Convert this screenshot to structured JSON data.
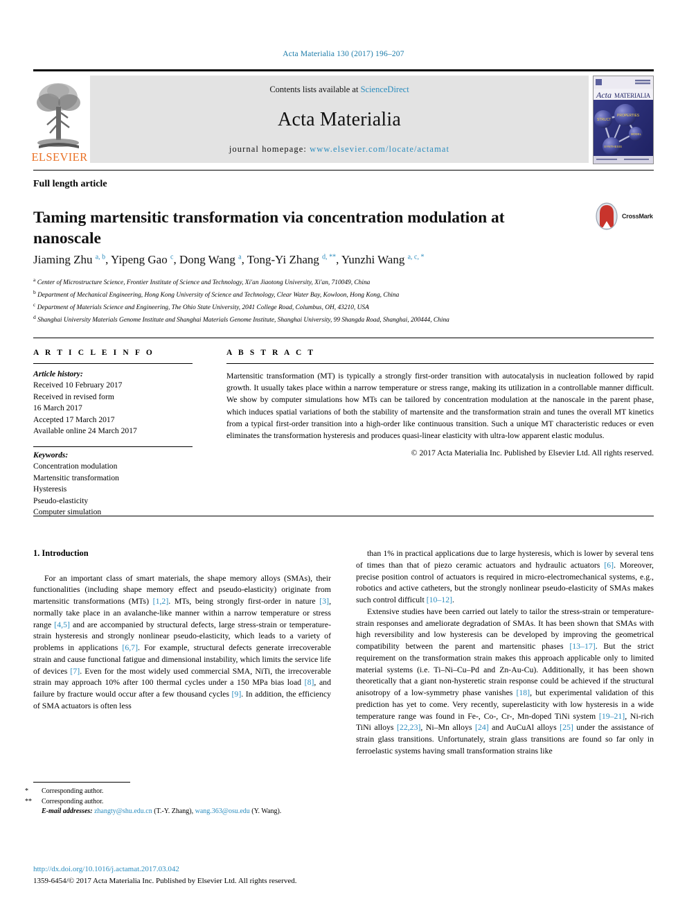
{
  "running_head": "Acta Materialia 130 (2017) 196–207",
  "masthead": {
    "publisher_name": "ELSEVIER",
    "contents_prefix": "Contents lists available at ",
    "contents_link": "ScienceDirect",
    "journal_name": "Acta Materialia",
    "homepage_prefix": "journal homepage: ",
    "homepage_url": "www.elsevier.com/locate/actamat",
    "cover_title_1": "Acta",
    "cover_title_2": "MATERIALIA",
    "cover_nodes": [
      "STRUCTURE",
      "PROPERTIES",
      "MODELING",
      "SYNTHESIS"
    ]
  },
  "article_type": "Full length article",
  "title": "Taming martensitic transformation via concentration modulation at nanoscale",
  "crossmark": {
    "label": "CrossMark"
  },
  "authors_html": "Jiaming Zhu <sup>a, b</sup>, Yipeng Gao <sup>c</sup>, Dong Wang <sup>a</sup>, Tong-Yi Zhang <sup>d, **</sup>, Yunzhi Wang <sup>a, c, *</sup>",
  "affiliations": [
    {
      "marker": "a",
      "text": "Center of Microstructure Science, Frontier Institute of Science and Technology, Xi'an Jiaotong University, Xi'an, 710049, China"
    },
    {
      "marker": "b",
      "text": "Department of Mechanical Engineering, Hong Kong University of Science and Technology, Clear Water Bay, Kowloon, Hong Kong, China"
    },
    {
      "marker": "c",
      "text": "Department of Materials Science and Engineering, The Ohio State University, 2041 College Road, Columbus, OH, 43210, USA"
    },
    {
      "marker": "d",
      "text": "Shanghai University Materials Genome Institute and Shanghai Materials Genome Institute, Shanghai University, 99 Shangda Road, Shanghai, 200444, China"
    }
  ],
  "article_info": {
    "heading": "A R T I C L E  I N F O",
    "history_label": "Article history:",
    "history_lines": [
      "Received 10 February 2017",
      "Received in revised form",
      "16 March 2017",
      "Accepted 17 March 2017",
      "Available online 24 March 2017"
    ],
    "keywords_label": "Keywords:",
    "keywords": [
      "Concentration modulation",
      "Martensitic transformation",
      "Hysteresis",
      "Pseudo-elasticity",
      "Computer simulation"
    ]
  },
  "abstract": {
    "heading": "A B S T R A C T",
    "text": "Martensitic transformation (MT) is typically a strongly first-order transition with autocatalysis in nucleation followed by rapid growth. It usually takes place within a narrow temperature or stress range, making its utilization in a controllable manner difficult. We show by computer simulations how MTs can be tailored by concentration modulation at the nanoscale in the parent phase, which induces spatial variations of both the stability of martensite and the transformation strain and tunes the overall MT kinetics from a typical first-order transition into a high-order like continuous transition. Such a unique MT characteristic reduces or even eliminates the transformation hysteresis and produces quasi-linear elasticity with ultra-low apparent elastic modulus.",
    "copyright": "© 2017 Acta Materialia Inc. Published by Elsevier Ltd. All rights reserved."
  },
  "body": {
    "section_title": "1. Introduction",
    "left_paragraphs_html": [
      "For an important class of smart materials, the shape memory alloys (SMAs), their functionalities (including shape memory effect and pseudo-elasticity) originate from martensitic transformations (MTs) <span class=\"cite\">[1,2]</span>. MTs, being strongly first-order in nature <span class=\"cite\">[3]</span>, normally take place in an avalanche-like manner within a narrow temperature or stress range <span class=\"cite\">[4,5]</span> and are accompanied by structural defects, large stress-strain or temperature-strain hysteresis and strongly nonlinear pseudo-elasticity, which leads to a variety of problems in applications <span class=\"cite\">[6,7]</span>. For example, structural defects generate irrecoverable strain and cause functional fatigue and dimensional instability, which limits the service life of devices <span class=\"cite\">[7]</span>. Even for the most widely used commercial SMA, NiTi, the irrecoverable strain may approach 10% after 100 thermal cycles under a 150 MPa bias load <span class=\"cite\">[8]</span>, and failure by fracture would occur after a few thousand cycles <span class=\"cite\">[9]</span>. In addition, the efficiency of SMA actuators is often less"
    ],
    "right_paragraphs_html": [
      "than 1% in practical applications due to large hysteresis, which is lower by several tens of times than that of piezo ceramic actuators and hydraulic actuators <span class=\"cite\">[6]</span>. Moreover, precise position control of actuators is required in micro-electromechanical systems, e.g., robotics and active catheters, but the strongly nonlinear pseudo-elasticity of SMAs makes such control difficult <span class=\"cite\">[10–12]</span>.",
      "Extensive studies have been carried out lately to tailor the stress-strain or temperature-strain responses and ameliorate degradation of SMAs. It has been shown that SMAs with high reversibility and low hysteresis can be developed by improving the geometrical compatibility between the parent and martensitic phases <span class=\"cite\">[13–17]</span>. But the strict requirement on the transformation strain makes this approach applicable only to limited material systems (i.e. Ti–Ni–Cu–Pd and Zn-Au-Cu). Additionally, it has been shown theoretically that a giant non-hysteretic strain response could be achieved if the structural anisotropy of a low-symmetry phase vanishes <span class=\"cite\">[18]</span>, but experimental validation of this prediction has yet to come. Very recently, superelasticity with low hysteresis in a wide temperature range was found in Fe-, Co-, Cr-, Mn-doped TiNi system <span class=\"cite\">[19–21]</span>, Ni-rich TiNi alloys <span class=\"cite\">[22,23]</span>, Ni–Mn alloys <span class=\"cite\">[24]</span> and AuCuAl alloys <span class=\"cite\">[25]</span> under the assistance of strain glass transitions. Unfortunately, strain glass transitions are found so far only in ferroelastic systems having small transformation strains like"
    ]
  },
  "footnotes": {
    "line1_marker": "*",
    "line1_text": "Corresponding author.",
    "line2_marker": "**",
    "line2_text": "Corresponding author.",
    "email_label": "E-mail addresses:",
    "email_1": "zhangty@shu.edu.cn",
    "email_1_owner": "(T.-Y. Zhang)",
    "email_2": "wang.363@osu.edu",
    "email_2_owner": "(Y. Wang)."
  },
  "doi": {
    "url": "http://dx.doi.org/10.1016/j.actamat.2017.03.042",
    "issn_line": "1359-6454/© 2017 Acta Materialia Inc. Published by Elsevier Ltd. All rights reserved."
  },
  "colors": {
    "link_blue": "#2b8cbe",
    "running_head_blue": "#1a7aa8",
    "elsevier_orange": "#ea7125",
    "band_gray": "#e3e3e3",
    "cover_blue": "#2a2f7a"
  }
}
